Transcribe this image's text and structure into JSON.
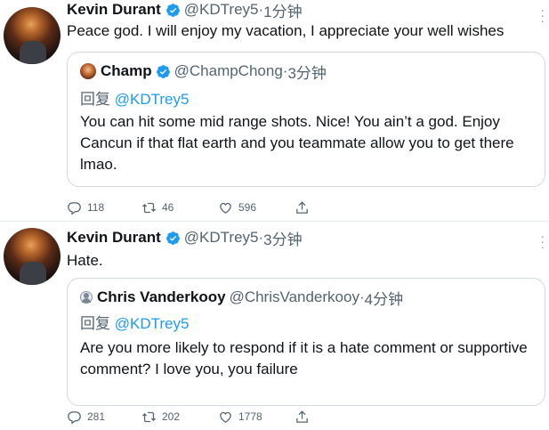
{
  "colors": {
    "accent": "#1d9bf0",
    "muted": "#536471",
    "text": "#0f1419",
    "border": "#cfd9de"
  },
  "tweets": [
    {
      "author_name": "Kevin Durant",
      "author_handle": "@KDTrey5",
      "time": "1分钟",
      "verified": true,
      "text": "Peace god. I will enjoy my vacation, I appreciate your well wishes",
      "quote": {
        "author_name": "Champ",
        "author_handle": "@ChampChong",
        "time": "3分钟",
        "verified": true,
        "reply_prefix": "回复",
        "reply_target": "@KDTrey5",
        "text": "You can hit some mid range shots. Nice! You ain’t a god. Enjoy Cancun if that flat earth and you teammate allow you to get there lmao."
      },
      "stats": {
        "replies": "118",
        "retweets": "46",
        "likes": "596"
      }
    },
    {
      "author_name": "Kevin Durant",
      "author_handle": "@KDTrey5",
      "time": "3分钟",
      "verified": true,
      "text": "Hate.",
      "quote": {
        "author_name": "Chris Vanderkooy",
        "author_handle": "@ChrisVanderkooy",
        "time": "4分钟",
        "verified": false,
        "reply_prefix": "回复",
        "reply_target": "@KDTrey5",
        "text": "Are you more likely to respond if it is a hate comment or supportive comment? I love you, you failure"
      },
      "stats": {
        "replies": "281",
        "retweets": "202",
        "likes": "1778"
      }
    }
  ],
  "icons": {
    "reply": "reply-icon",
    "retweet": "retweet-icon",
    "like": "heart-icon",
    "share": "share-icon",
    "verified": "verified-badge-icon",
    "more": "more-icon"
  },
  "separator": "·"
}
